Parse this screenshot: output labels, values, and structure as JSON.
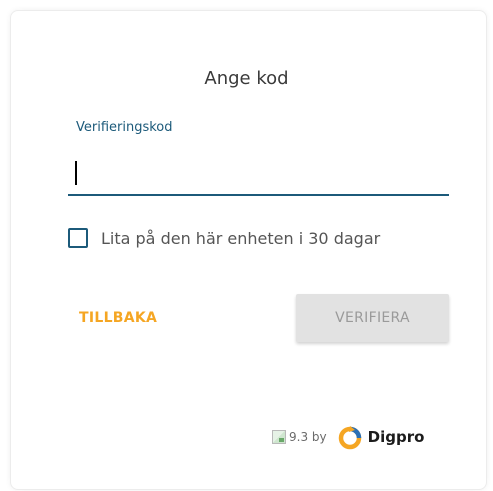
{
  "form": {
    "title": "Ange kod",
    "code_label": "Verifieringskod",
    "code_value": "",
    "trust_device_label": "Lita på den här enheten i 30 dagar",
    "trust_device_checked": false,
    "back_label": "TILLBAKA",
    "verify_label": "VERIFIERA"
  },
  "footer": {
    "version_text": "9.3 by",
    "brand": "Digpro"
  },
  "icons": {
    "version_image": "broken-image-icon",
    "brand_logo": "digpro-logo-icon"
  },
  "colors": {
    "accent": "#1c5a7a",
    "back_link": "#f5a623",
    "verify_disabled_bg": "#e2e2e2",
    "verify_disabled_text": "#9a9a9a",
    "logo_orange": "#f5a623",
    "logo_blue": "#2a6fb5"
  }
}
